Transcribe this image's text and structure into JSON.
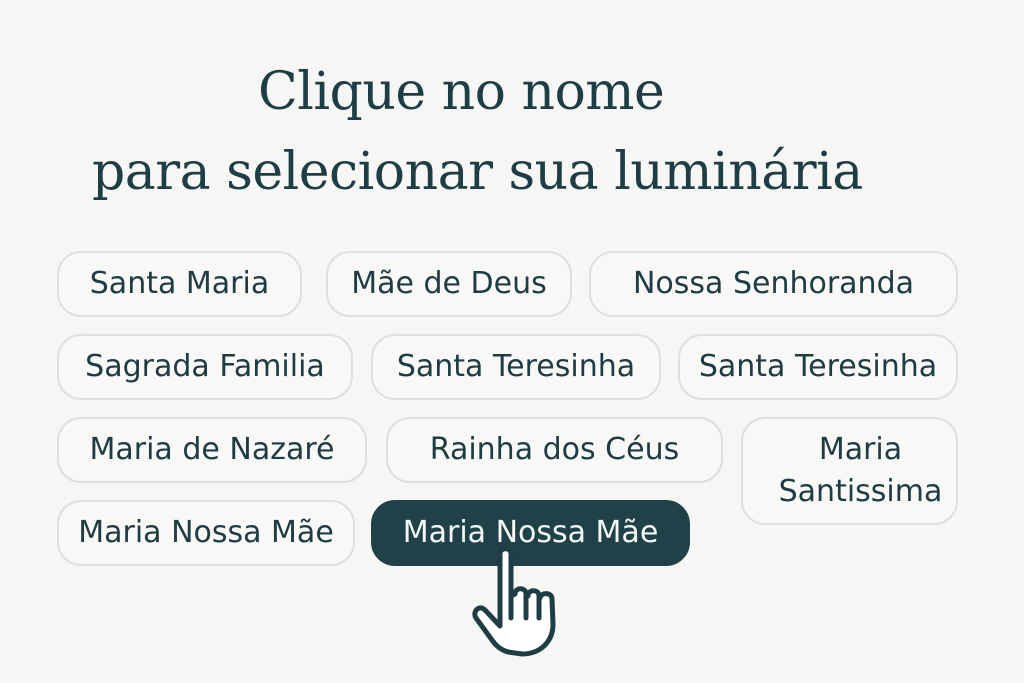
{
  "heading": {
    "line1": "Clique no nome",
    "line2": "para selecionar sua luminária"
  },
  "options": [
    "Santa Maria",
    "Mãe de Deus",
    "Nossa Senhoranda",
    "Sagrada Familia",
    "Santa Teresinha",
    "Santa Teresinha",
    "Maria de Nazaré",
    "Rainha dos Céus",
    "Maria Santissima",
    "Maria Nossa Mãe",
    "Maria Nossa Mãe"
  ],
  "selected_option": "Maria Nossa Mãe",
  "cursor_icon": "hand-pointer-icon",
  "colors": {
    "background": "#f6f6f4",
    "text": "#1f3d44",
    "chip_border": "#dfdfdd",
    "selected_fill": "#1f4147",
    "selected_text": "#f4f7f7"
  }
}
